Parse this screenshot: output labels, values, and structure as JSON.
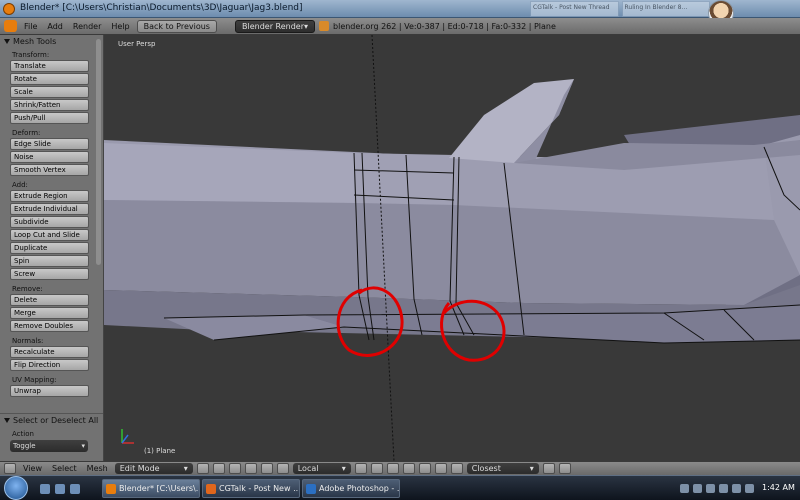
{
  "window": {
    "title": "Blender* [C:\\Users\\Christian\\Documents\\3D\\Jaguar\\Jag3.blend]",
    "ghost_tabs": [
      "CGTalk - Post New Thread",
      "Ruling In Blender 8..."
    ]
  },
  "header": {
    "menus": [
      "File",
      "Add",
      "Render",
      "Help"
    ],
    "back_button": "Back to Previous",
    "render_engine": "Blender Render",
    "stats": "blender.org 262 | Ve:0-387 | Ed:0-718 | Fa:0-332 | Plane"
  },
  "toolshelf": {
    "title": "Mesh Tools",
    "sections": [
      {
        "label": "Transform:",
        "buttons": [
          "Translate",
          "Rotate",
          "Scale",
          "Shrink/Fatten",
          "Push/Pull"
        ]
      },
      {
        "label": "Deform:",
        "buttons": [
          "Edge Slide",
          "Noise",
          "Smooth Vertex"
        ]
      },
      {
        "label": "Add:",
        "buttons": [
          "Extrude Region",
          "Extrude Individual",
          "Subdivide",
          "Loop Cut and Slide",
          "Duplicate",
          "Spin",
          "Screw"
        ]
      },
      {
        "label": "Remove:",
        "buttons": [
          "Delete",
          "Merge",
          "Remove Doubles"
        ]
      },
      {
        "label": "Normals:",
        "buttons": [
          "Recalculate",
          "Flip Direction"
        ]
      },
      {
        "label": "UV Mapping:",
        "buttons": [
          "Unwrap"
        ]
      }
    ],
    "operator": {
      "title": "Select or Deselect All",
      "action_label": "Action",
      "action_value": "Toggle"
    }
  },
  "viewport": {
    "view_label": "User Persp",
    "object_label": "(1) Plane",
    "annotation_color": "#e00000",
    "mesh_color": "#a3a3b8"
  },
  "footer": {
    "menus": [
      "View",
      "Select",
      "Mesh"
    ],
    "mode": "Edit Mode",
    "orientation": "Local",
    "snap": "Closest"
  },
  "taskbar": {
    "tasks": [
      "Blender* [C:\\Users\\...",
      "CGTalk - Post New ...",
      "Adobe Photoshop - ..."
    ],
    "clock": "1:42 AM"
  }
}
